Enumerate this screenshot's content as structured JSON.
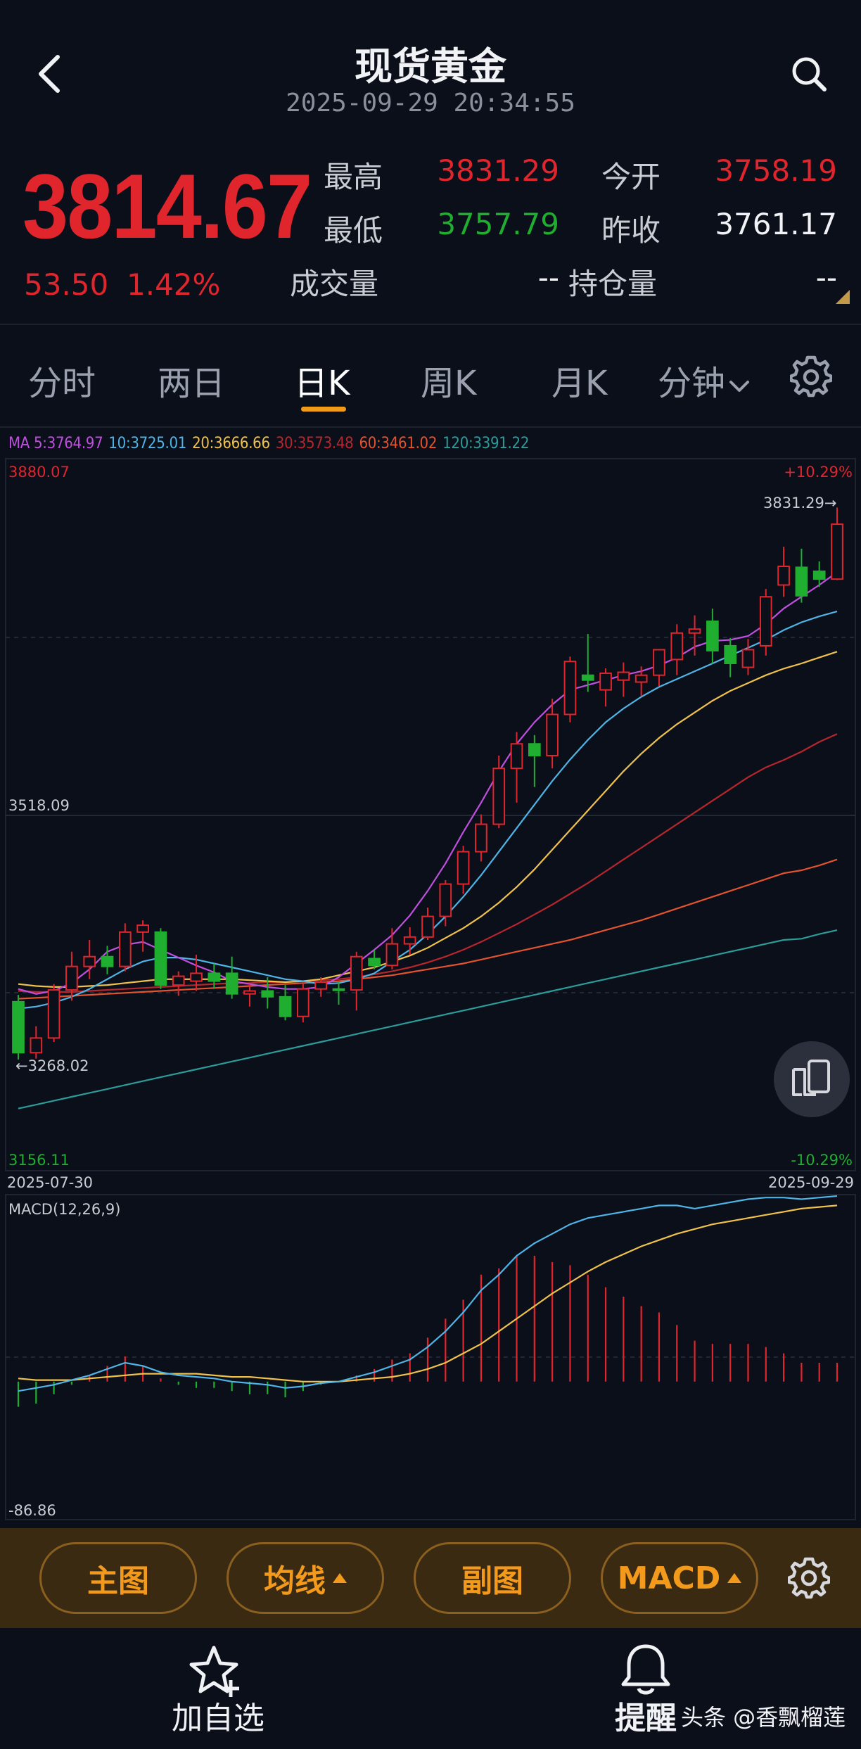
{
  "header": {
    "title": "现货黄金",
    "timestamp": "2025-09-29 20:34:55"
  },
  "quote": {
    "last_price": "3814.67",
    "change_abs": "53.50",
    "change_pct": "1.42%",
    "high_label": "最高",
    "high_value": "3831.29",
    "open_label": "今开",
    "open_value": "3758.19",
    "low_label": "最低",
    "low_value": "3757.79",
    "prev_close_label": "昨收",
    "prev_close_value": "3761.17",
    "volume_label": "成交量",
    "volume_value": "--",
    "open_interest_label": "持仓量",
    "open_interest_value": "--"
  },
  "tabs": [
    {
      "label": "分时",
      "active": false
    },
    {
      "label": "两日",
      "active": false
    },
    {
      "label": "日K",
      "active": true
    },
    {
      "label": "周K",
      "active": false
    },
    {
      "label": "月K",
      "active": false
    },
    {
      "label": "分钟",
      "active": false
    }
  ],
  "ma_legend": {
    "ma5": "MA 5:3764.97",
    "ma10": "10:3725.01",
    "ma20": "20:3666.66",
    "ma30": "30:3573.48",
    "ma60": "60:3461.02",
    "ma120": "120:3391.22"
  },
  "colors": {
    "up": "#e0252c",
    "down": "#1fae2f",
    "ma5": "#c04fe0",
    "ma10": "#4fb4e6",
    "ma20": "#f0c24a",
    "ma30": "#b8262d",
    "ma60": "#e2532e",
    "ma120": "#2b9c9a",
    "accent": "#f19b1b"
  },
  "chart_data": [
    {
      "type": "candlestick",
      "ylim": [
        3156.11,
        3880.07
      ],
      "y_top_label": "3880.07",
      "y_mid_label": "3518.09",
      "y_bottom_label": "3156.11",
      "pct_top_label": "+10.29%",
      "pct_bottom_label": "-10.29%",
      "max_label": "3831.29",
      "min_label": "3268.02",
      "x_start_label": "2025-07-30",
      "x_end_label": "2025-09-29",
      "candles": [
        {
          "o": 3327,
          "h": 3334,
          "l": 3268,
          "c": 3275
        },
        {
          "o": 3275,
          "h": 3302,
          "l": 3269,
          "c": 3290
        },
        {
          "o": 3290,
          "h": 3345,
          "l": 3286,
          "c": 3339
        },
        {
          "o": 3339,
          "h": 3378,
          "l": 3328,
          "c": 3363
        },
        {
          "o": 3363,
          "h": 3390,
          "l": 3350,
          "c": 3373
        },
        {
          "o": 3373,
          "h": 3384,
          "l": 3355,
          "c": 3363
        },
        {
          "o": 3363,
          "h": 3407,
          "l": 3358,
          "c": 3398
        },
        {
          "o": 3398,
          "h": 3410,
          "l": 3378,
          "c": 3405
        },
        {
          "o": 3398,
          "h": 3402,
          "l": 3340,
          "c": 3344
        },
        {
          "o": 3344,
          "h": 3358,
          "l": 3333,
          "c": 3353
        },
        {
          "o": 3348,
          "h": 3375,
          "l": 3338,
          "c": 3356
        },
        {
          "o": 3356,
          "h": 3366,
          "l": 3340,
          "c": 3348
        },
        {
          "o": 3356,
          "h": 3373,
          "l": 3330,
          "c": 3335
        },
        {
          "o": 3335,
          "h": 3345,
          "l": 3322,
          "c": 3338
        },
        {
          "o": 3338,
          "h": 3352,
          "l": 3320,
          "c": 3332
        },
        {
          "o": 3332,
          "h": 3344,
          "l": 3308,
          "c": 3312
        },
        {
          "o": 3312,
          "h": 3345,
          "l": 3306,
          "c": 3340
        },
        {
          "o": 3340,
          "h": 3352,
          "l": 3332,
          "c": 3347
        },
        {
          "o": 3340,
          "h": 3347,
          "l": 3324,
          "c": 3339
        },
        {
          "o": 3339,
          "h": 3378,
          "l": 3318,
          "c": 3373
        },
        {
          "o": 3371,
          "h": 3380,
          "l": 3360,
          "c": 3364
        },
        {
          "o": 3364,
          "h": 3402,
          "l": 3360,
          "c": 3386
        },
        {
          "o": 3386,
          "h": 3403,
          "l": 3375,
          "c": 3393
        },
        {
          "o": 3393,
          "h": 3423,
          "l": 3390,
          "c": 3414
        },
        {
          "o": 3414,
          "h": 3451,
          "l": 3404,
          "c": 3447
        },
        {
          "o": 3447,
          "h": 3486,
          "l": 3437,
          "c": 3480
        },
        {
          "o": 3480,
          "h": 3518,
          "l": 3470,
          "c": 3508
        },
        {
          "o": 3508,
          "h": 3578,
          "l": 3504,
          "c": 3565
        },
        {
          "o": 3565,
          "h": 3602,
          "l": 3530,
          "c": 3590
        },
        {
          "o": 3590,
          "h": 3599,
          "l": 3546,
          "c": 3578
        },
        {
          "o": 3578,
          "h": 3636,
          "l": 3565,
          "c": 3620
        },
        {
          "o": 3620,
          "h": 3679,
          "l": 3612,
          "c": 3674
        },
        {
          "o": 3660,
          "h": 3702,
          "l": 3643,
          "c": 3655
        },
        {
          "o": 3645,
          "h": 3667,
          "l": 3628,
          "c": 3662
        },
        {
          "o": 3655,
          "h": 3673,
          "l": 3638,
          "c": 3663
        },
        {
          "o": 3653,
          "h": 3669,
          "l": 3639,
          "c": 3660
        },
        {
          "o": 3660,
          "h": 3680,
          "l": 3649,
          "c": 3686
        },
        {
          "o": 3676,
          "h": 3712,
          "l": 3660,
          "c": 3703
        },
        {
          "o": 3703,
          "h": 3721,
          "l": 3680,
          "c": 3707
        },
        {
          "o": 3715,
          "h": 3728,
          "l": 3672,
          "c": 3685
        },
        {
          "o": 3690,
          "h": 3698,
          "l": 3658,
          "c": 3672
        },
        {
          "o": 3668,
          "h": 3697,
          "l": 3660,
          "c": 3686
        },
        {
          "o": 3690,
          "h": 3748,
          "l": 3680,
          "c": 3740
        },
        {
          "o": 3752,
          "h": 3791,
          "l": 3740,
          "c": 3771
        },
        {
          "o": 3770,
          "h": 3789,
          "l": 3734,
          "c": 3741
        },
        {
          "o": 3766,
          "h": 3776,
          "l": 3750,
          "c": 3758
        },
        {
          "o": 3758,
          "h": 3831,
          "l": 3757,
          "c": 3814
        }
      ],
      "ma5": [
        3340,
        3335,
        3338,
        3346,
        3360,
        3378,
        3385,
        3388,
        3380,
        3372,
        3364,
        3357,
        3348,
        3345,
        3342,
        3340,
        3340,
        3342,
        3352,
        3366,
        3380,
        3395,
        3415,
        3440,
        3468,
        3500,
        3530,
        3562,
        3590,
        3612,
        3630,
        3645,
        3650,
        3655,
        3660,
        3664,
        3670,
        3678,
        3689,
        3695,
        3696,
        3700,
        3712,
        3728,
        3740,
        3752,
        3764.97
      ],
      "ma10": [
        3320,
        3322,
        3326,
        3332,
        3340,
        3350,
        3360,
        3368,
        3372,
        3372,
        3370,
        3366,
        3362,
        3358,
        3354,
        3350,
        3348,
        3345,
        3346,
        3350,
        3356,
        3368,
        3380,
        3396,
        3414,
        3434,
        3456,
        3480,
        3504,
        3528,
        3552,
        3574,
        3594,
        3612,
        3626,
        3638,
        3648,
        3656,
        3664,
        3672,
        3680,
        3688,
        3696,
        3706,
        3714,
        3720,
        3725.01
      ],
      "ma20": [
        3345,
        3343,
        3342,
        3342,
        3343,
        3344,
        3346,
        3348,
        3350,
        3350,
        3350,
        3350,
        3350,
        3349,
        3348,
        3347,
        3348,
        3350,
        3354,
        3358,
        3362,
        3368,
        3374,
        3382,
        3392,
        3402,
        3414,
        3428,
        3444,
        3462,
        3482,
        3502,
        3522,
        3542,
        3562,
        3580,
        3596,
        3610,
        3622,
        3634,
        3644,
        3652,
        3660,
        3666.66,
        3672,
        3678,
        3684
      ],
      "ma30": [
        3338,
        3337,
        3337,
        3337,
        3338,
        3339,
        3340,
        3341,
        3342,
        3343,
        3344,
        3345,
        3346,
        3346,
        3347,
        3347,
        3348,
        3349,
        3350,
        3352,
        3355,
        3358,
        3362,
        3367,
        3373,
        3380,
        3388,
        3397,
        3406,
        3416,
        3426,
        3437,
        3448,
        3460,
        3472,
        3484,
        3496,
        3508,
        3520,
        3532,
        3544,
        3556,
        3566,
        3573.48,
        3582,
        3592,
        3600
      ],
      "ma60": [
        3330,
        3331,
        3332,
        3333,
        3334,
        3335,
        3336,
        3337,
        3338,
        3339,
        3340,
        3341,
        3342,
        3343,
        3344,
        3345,
        3346,
        3347,
        3348,
        3350,
        3352,
        3354,
        3357,
        3360,
        3363,
        3366,
        3370,
        3374,
        3378,
        3382,
        3386,
        3390,
        3395,
        3400,
        3405,
        3410,
        3416,
        3422,
        3428,
        3434,
        3440,
        3446,
        3452,
        3458,
        3461.02,
        3466,
        3472
      ],
      "ma120": [
        3218,
        3222,
        3226,
        3230,
        3234,
        3238,
        3242,
        3246,
        3250,
        3254,
        3258,
        3262,
        3266,
        3270,
        3274,
        3278,
        3282,
        3286,
        3290,
        3294,
        3298,
        3302,
        3306,
        3310,
        3314,
        3318,
        3322,
        3326,
        3330,
        3334,
        3338,
        3342,
        3346,
        3350,
        3354,
        3358,
        3362,
        3366,
        3370,
        3374,
        3378,
        3382,
        3386,
        3390,
        3391.22,
        3396,
        3400
      ]
    },
    {
      "type": "macd",
      "title": "MACD(12,26,9)",
      "min_label": "-86.86",
      "ylim": [
        -86.86,
        118
      ],
      "dif": [
        -6,
        -4,
        -2,
        1,
        4,
        8,
        12,
        10,
        6,
        4,
        3,
        2,
        0,
        -1,
        -2,
        -4,
        -3,
        -1,
        0,
        3,
        6,
        10,
        14,
        22,
        32,
        44,
        58,
        68,
        80,
        88,
        94,
        100,
        104,
        106,
        108,
        110,
        112,
        112,
        110,
        112,
        114,
        116,
        117,
        117,
        116,
        117,
        118
      ],
      "dea": [
        2,
        1,
        1,
        1,
        2,
        3,
        4,
        5,
        5,
        5,
        5,
        4,
        3,
        3,
        2,
        1,
        0,
        0,
        0,
        1,
        2,
        3,
        5,
        8,
        12,
        18,
        24,
        32,
        40,
        48,
        56,
        63,
        70,
        76,
        81,
        86,
        90,
        94,
        97,
        100,
        102,
        104,
        106,
        108,
        110,
        111,
        112
      ],
      "hist": [
        -16,
        -14,
        -8,
        -2,
        4,
        10,
        16,
        10,
        2,
        -2,
        -4,
        -4,
        -6,
        -8,
        -8,
        -10,
        -6,
        -2,
        0,
        4,
        8,
        14,
        18,
        28,
        40,
        52,
        68,
        72,
        80,
        80,
        76,
        74,
        68,
        60,
        54,
        48,
        44,
        36,
        26,
        24,
        24,
        24,
        22,
        18,
        12,
        12,
        12
      ]
    }
  ],
  "toolbar": {
    "main_chart": "主图",
    "ma": "均线",
    "sub_chart": "副图",
    "macd": "MACD"
  },
  "bottom_nav": {
    "favorite": "加自选",
    "alert": "提醒",
    "watermark": "头条 @香飘榴莲"
  }
}
